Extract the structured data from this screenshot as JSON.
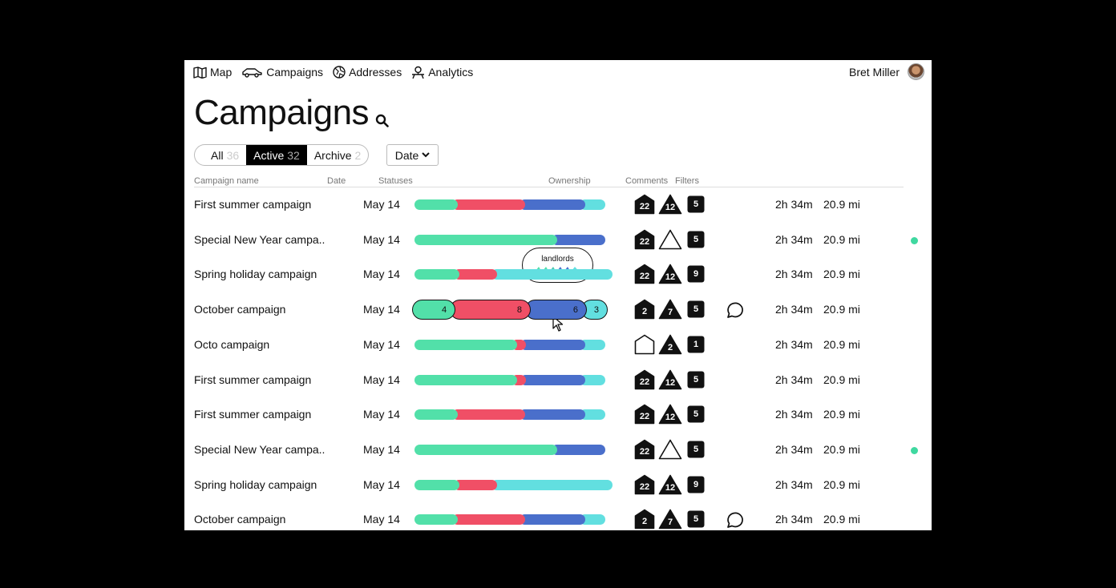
{
  "nav": {
    "items": [
      {
        "label": "Map",
        "icon": "map-icon"
      },
      {
        "label": "Campaigns",
        "icon": "car-icon"
      },
      {
        "label": "Addresses",
        "icon": "globe-icon"
      },
      {
        "label": "Analytics",
        "icon": "person-icon"
      }
    ]
  },
  "user": {
    "name": "Bret Miller"
  },
  "page": {
    "title": "Campaigns"
  },
  "filters": {
    "tabs": [
      {
        "label": "All",
        "count": "36"
      },
      {
        "label": "Active",
        "count": "32",
        "selected": true
      },
      {
        "label": "Archive",
        "count": "2"
      }
    ],
    "date_label": "Date"
  },
  "table": {
    "headers": {
      "name": "Campaign name",
      "date": "Date",
      "statuses": "Statuses",
      "ownership": "Ownership",
      "comments": "Comments",
      "filters": "Filters"
    },
    "rows": [
      {
        "name": "First summer campaign",
        "date": "May 14",
        "status": [
          0.2,
          0.36,
          0.32,
          0.14
        ],
        "house": "22",
        "tri": "12",
        "sq": "5",
        "comment": false,
        "time": "2h 34m",
        "dist": "20.9 mi",
        "dot": false
      },
      {
        "name": "Special New Year campa..",
        "date": "May 14",
        "status": [
          0.72,
          0.28
        ],
        "status_colors": [
          "green",
          "blue"
        ],
        "house": "22",
        "tri": "",
        "sq": "5",
        "comment": false,
        "time": "2h 34m",
        "dist": "20.9 mi",
        "dot": true
      },
      {
        "name": "Spring holiday campaign",
        "date": "May 14",
        "status": [
          0.2,
          0.19,
          0.61
        ],
        "status_colors": [
          "green",
          "red",
          "cyan"
        ],
        "house": "22",
        "tri": "12",
        "sq": "9",
        "comment": false,
        "time": "2h 34m",
        "dist": "20.9 mi",
        "dot": false
      },
      {
        "name": "October campaign",
        "date": "May 14",
        "status": [
          0.2,
          0.4,
          0.3,
          0.14
        ],
        "labels": [
          "4",
          "8",
          "6",
          "3"
        ],
        "house": "2",
        "tri": "7",
        "sq": "5",
        "comment": true,
        "time": "2h 34m",
        "dist": "20.9 mi",
        "dot": false
      },
      {
        "name": "Octo campaign",
        "date": "May 14",
        "status": [
          0.52,
          0.05,
          0.32,
          0.14
        ],
        "house": "",
        "tri": "2",
        "sq": "1",
        "comment": false,
        "time": "2h 34m",
        "dist": "20.9 mi",
        "dot": false
      },
      {
        "name": "First summer campaign",
        "date": "May 14",
        "status": [
          0.52,
          0.05,
          0.32,
          0.14
        ],
        "house": "22",
        "tri": "12",
        "sq": "5",
        "comment": false,
        "time": "2h 34m",
        "dist": "20.9 mi",
        "dot": false
      },
      {
        "name": "First summer campaign",
        "date": "May 14",
        "status": [
          0.2,
          0.36,
          0.32,
          0.14
        ],
        "house": "22",
        "tri": "12",
        "sq": "5",
        "comment": false,
        "time": "2h 34m",
        "dist": "20.9 mi",
        "dot": false
      },
      {
        "name": "Special New Year campa..",
        "date": "May 14",
        "status": [
          0.72,
          0.28
        ],
        "status_colors": [
          "green",
          "blue"
        ],
        "house": "22",
        "tri": "",
        "sq": "5",
        "comment": false,
        "time": "2h 34m",
        "dist": "20.9 mi",
        "dot": true
      },
      {
        "name": "Spring holiday campaign",
        "date": "May 14",
        "status": [
          0.2,
          0.19,
          0.61
        ],
        "status_colors": [
          "green",
          "red",
          "cyan"
        ],
        "house": "22",
        "tri": "12",
        "sq": "9",
        "comment": false,
        "time": "2h 34m",
        "dist": "20.9 mi",
        "dot": false
      },
      {
        "name": "October campaign",
        "date": "May 14",
        "status": [
          0.2,
          0.36,
          0.32,
          0.14
        ],
        "house": "2",
        "tri": "7",
        "sq": "5",
        "comment": true,
        "time": "2h 34m",
        "dist": "20.9 mi",
        "dot": false
      }
    ]
  },
  "tooltip": {
    "label": "landlords"
  },
  "colors": {
    "green": "#52e0a9",
    "red": "#f04f66",
    "blue": "#4a6fcb",
    "cyan": "#62dfe0",
    "dot": "#3fd8a0"
  }
}
